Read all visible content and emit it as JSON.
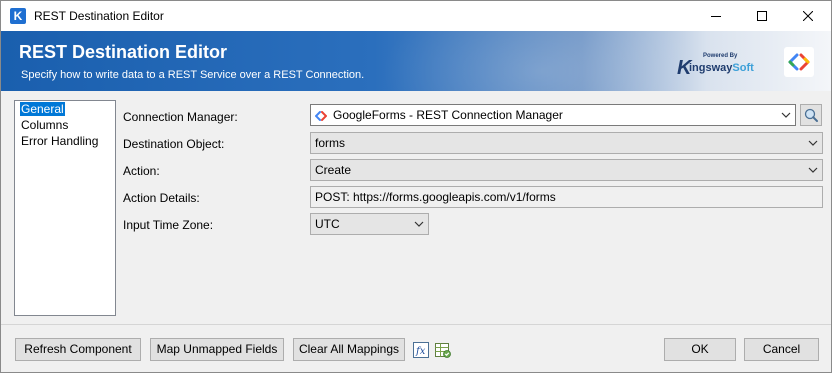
{
  "window": {
    "title": "REST Destination Editor"
  },
  "banner": {
    "title": "REST Destination Editor",
    "subtitle": "Specify how to write data to a REST Service over a REST Connection.",
    "brand_powered": "Powered By",
    "brand_k": "K",
    "brand_name_a": "ingsway",
    "brand_name_b": "Soft"
  },
  "nav": {
    "items": [
      "General",
      "Columns",
      "Error Handling"
    ],
    "selected": "General"
  },
  "form": {
    "connection_manager": {
      "label": "Connection Manager:",
      "value": "GoogleForms - REST Connection Manager"
    },
    "destination_object": {
      "label": "Destination Object:",
      "value": "forms"
    },
    "action": {
      "label": "Action:",
      "value": "Create"
    },
    "action_details": {
      "label": "Action Details:",
      "value": "POST: https://forms.googleapis.com/v1/forms"
    },
    "input_time_zone": {
      "label": "Input Time Zone:",
      "value": "UTC"
    }
  },
  "buttons": {
    "refresh": "Refresh Component",
    "map_unmapped": "Map Unmapped Fields",
    "clear_mappings": "Clear All Mappings",
    "ok": "OK",
    "cancel": "Cancel"
  },
  "colors": {
    "accent": "#0078d7",
    "banner": "#1a5fae",
    "brand": "#1f3c6e"
  },
  "icons": [
    "app-icon",
    "minimize-icon",
    "maximize-icon",
    "close-icon",
    "search-icon",
    "google-forms-icon",
    "chevron-down-icon",
    "fx-icon",
    "spreadsheet-icon"
  ]
}
